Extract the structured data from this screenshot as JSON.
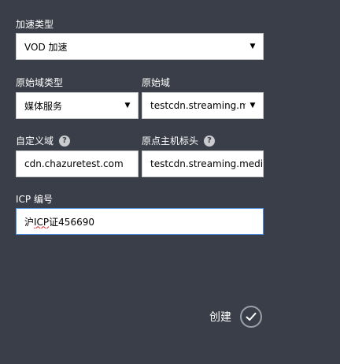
{
  "form": {
    "accel_type": {
      "label": "加速类型",
      "value": "VOD 加速"
    },
    "origin_type": {
      "label": "原始域类型",
      "value": "媒体服务"
    },
    "origin_domain": {
      "label": "原始域",
      "value": "testcdn.streaming.m"
    },
    "custom_domain": {
      "label": "自定义域",
      "value": "cdn.chazuretest.com"
    },
    "origin_host_header": {
      "label": "原点主机标头",
      "value": "testcdn.streaming.media"
    },
    "icp": {
      "label": "ICP 编号",
      "value_prefix": "沪",
      "value_marked": "ICP",
      "value_suffix": "证456690"
    }
  },
  "help_glyph": "?",
  "actions": {
    "create_label": "创建"
  }
}
